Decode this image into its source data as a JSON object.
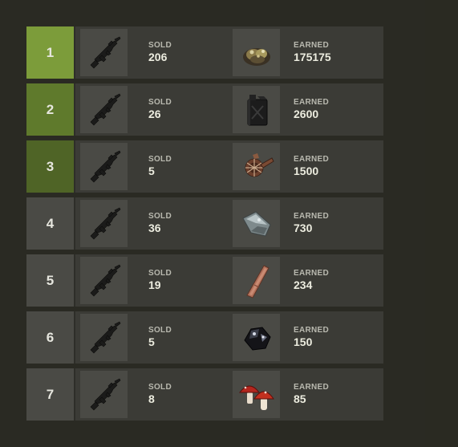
{
  "leaderboard": {
    "sold_label": "SOLD",
    "earned_label": "EARNED",
    "rows": [
      {
        "rank": "1",
        "sold": "206",
        "earned": "175175",
        "sold_icon": "smg-icon",
        "reward_icon": "ore-icon"
      },
      {
        "rank": "2",
        "sold": "26",
        "earned": "2600",
        "sold_icon": "smg-icon",
        "reward_icon": "fuel-can-icon"
      },
      {
        "rank": "3",
        "sold": "5",
        "earned": "1500",
        "sold_icon": "smg-icon",
        "reward_icon": "ammo-belt-icon"
      },
      {
        "rank": "4",
        "sold": "36",
        "earned": "730",
        "sold_icon": "smg-icon",
        "reward_icon": "metal-fragment-icon"
      },
      {
        "rank": "5",
        "sold": "19",
        "earned": "234",
        "sold_icon": "smg-icon",
        "reward_icon": "leather-strip-icon"
      },
      {
        "rank": "6",
        "sold": "5",
        "earned": "150",
        "sold_icon": "smg-icon",
        "reward_icon": "coal-icon"
      },
      {
        "rank": "7",
        "sold": "8",
        "earned": "85",
        "sold_icon": "smg-icon",
        "reward_icon": "mushroom-icon"
      }
    ]
  },
  "colors": {
    "rank_1": "#7c9c3a",
    "rank_2": "#5f7a2c",
    "rank_3": "#4f6426",
    "rank_default": "#4a4a45",
    "row_bg": "#3b3b36",
    "page_bg": "#2a2a22"
  }
}
